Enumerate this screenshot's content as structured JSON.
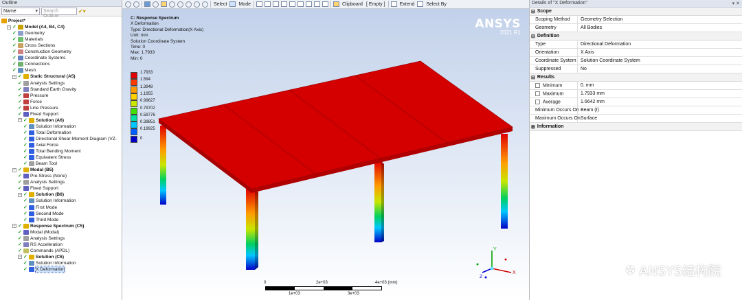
{
  "outline": {
    "title": "Outline",
    "filter_value": "Name",
    "search_placeholder": "Search Outline",
    "tree": [
      {
        "label": "Project*",
        "bold": true
      },
      {
        "label": "Model (A4, B4, C4)",
        "bold": true
      },
      {
        "label": "Geometry"
      },
      {
        "label": "Materials"
      },
      {
        "label": "Cross Sections"
      },
      {
        "label": "Construction Geometry"
      },
      {
        "label": "Coordinate Systems"
      },
      {
        "label": "Connections"
      },
      {
        "label": "Mesh"
      },
      {
        "label": "Static Structural (A5)",
        "bold": true
      },
      {
        "label": "Analysis Settings"
      },
      {
        "label": "Standard Earth Gravity"
      },
      {
        "label": "Pressure"
      },
      {
        "label": "Force"
      },
      {
        "label": "Line Pressure"
      },
      {
        "label": "Fixed Support"
      },
      {
        "label": "Solution (A6)",
        "bold": true
      },
      {
        "label": "Solution Information"
      },
      {
        "label": "Total Deformation"
      },
      {
        "label": "Directional Shear-Moment Diagram (VZ-"
      },
      {
        "label": "Axial Force"
      },
      {
        "label": "Total Bending Moment"
      },
      {
        "label": "Equivalent Stress"
      },
      {
        "label": "Beam Tool"
      },
      {
        "label": "Modal (B5)",
        "bold": true
      },
      {
        "label": "Pre-Stress (None)"
      },
      {
        "label": "Analysis Settings"
      },
      {
        "label": "Fixed Support"
      },
      {
        "label": "Solution (B6)",
        "bold": true
      },
      {
        "label": "Solution Information"
      },
      {
        "label": "First Mode"
      },
      {
        "label": "Second Mode"
      },
      {
        "label": "Third Mode"
      },
      {
        "label": "Response Spectrum (C5)",
        "bold": true
      },
      {
        "label": "Modal (Modal)"
      },
      {
        "label": "Analysis Settings"
      },
      {
        "label": "RS Acceleration"
      },
      {
        "label": "Commands (APDL)"
      },
      {
        "label": "Solution (C6)",
        "bold": true
      },
      {
        "label": "Solution Information"
      },
      {
        "label": "X Deformation",
        "selected": true
      }
    ]
  },
  "toolbar": {
    "select": "Select",
    "mode": "Mode",
    "clipboard": "Clipboard",
    "empty": "[ Empty ]",
    "extend": "Extend",
    "select_by": "Select By"
  },
  "viewport": {
    "info": {
      "title": "C: Response Spectrum",
      "line1": "X Deformation",
      "line2": "Type: Directional Deformation(X Axis)",
      "line3": "Unit: mm",
      "line4": "Solution Coordinate System",
      "line5": "Time: 0",
      "line6": "Max: 1.7933",
      "line7": "Min: 0"
    },
    "brand": "ANSYS",
    "version": "2021 R1",
    "legend": [
      {
        "label": "1.7933",
        "color": "#e00000"
      },
      {
        "label": "1.594",
        "color": "#ff3a00"
      },
      {
        "label": "1.3948",
        "color": "#ff9a00"
      },
      {
        "label": "1.1955",
        "color": "#ffd200"
      },
      {
        "label": "0.99627",
        "color": "#c8e600"
      },
      {
        "label": "0.79702",
        "color": "#40e000"
      },
      {
        "label": "0.59776",
        "color": "#00e0a0"
      },
      {
        "label": "0.39851",
        "color": "#00c8ff"
      },
      {
        "label": "0.19925",
        "color": "#0060ff"
      },
      {
        "label": "0",
        "color": "#0000c8"
      }
    ],
    "scale": {
      "t0": "0",
      "t2": "2e+03",
      "t4": "4e+03 (mm)",
      "t1": "1e+03",
      "t3": "3e+03"
    }
  },
  "details": {
    "title": "Details of \"X Deformation\"",
    "sections": {
      "scope": "Scope",
      "definition": "Definition",
      "results": "Results",
      "information": "Information"
    },
    "scope_rows": [
      {
        "k": "Scoping Method",
        "v": "Geometry Selection"
      },
      {
        "k": "Geometry",
        "v": "All Bodies"
      }
    ],
    "definition_rows": [
      {
        "k": "Type",
        "v": "Directional Deformation"
      },
      {
        "k": "Orientation",
        "v": "X Axis"
      },
      {
        "k": "Coordinate System",
        "v": "Solution Coordinate System"
      },
      {
        "k": "Suppressed",
        "v": "No"
      }
    ],
    "results_rows": [
      {
        "k": "Minimum",
        "v": "0. mm",
        "cb": true
      },
      {
        "k": "Maximum",
        "v": "1.7933 mm",
        "cb": true
      },
      {
        "k": "Average",
        "v": "1.6642 mm",
        "cb": true
      },
      {
        "k": "Minimum Occurs On",
        "v": "Beam (I)"
      },
      {
        "k": "Maximum Occurs On",
        "v": "Surface"
      }
    ]
  },
  "watermark": "ANSYS结构院"
}
